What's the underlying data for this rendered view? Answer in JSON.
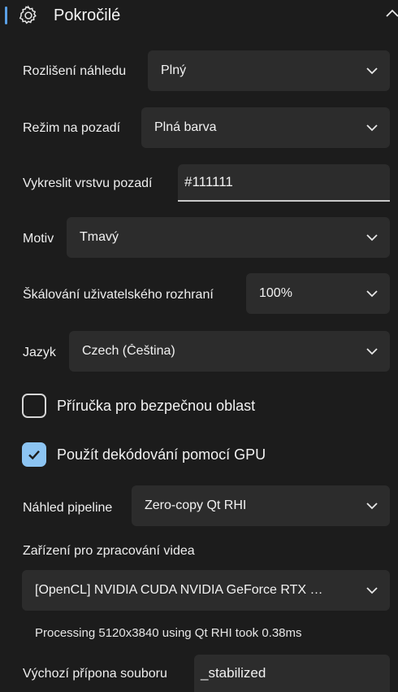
{
  "section": {
    "title": "Pokročilé",
    "gear_icon": "gear-icon",
    "collapse_icon": "chevron-up-icon"
  },
  "preview_resolution": {
    "label": "Rozlišení náhledu",
    "value": "Plný"
  },
  "background_mode": {
    "label": "Režim na pozadí",
    "value": "Plná barva"
  },
  "background_layer": {
    "label": "Vykreslit vrstvu pozadí",
    "value": "#111111"
  },
  "theme": {
    "label": "Motiv",
    "value": "Tmavý"
  },
  "ui_scale": {
    "label": "Škálování uživatelského rozhraní",
    "value": "100%"
  },
  "language": {
    "label": "Jazyk",
    "value": "Czech (Čeština)"
  },
  "safe_area_guide": {
    "label": "Příručka pro bezpečnou oblast",
    "checked": false
  },
  "gpu_decoding": {
    "label": "Použít dekódování pomocí GPU",
    "checked": true
  },
  "preview_pipeline": {
    "label": "Náhled pipeline",
    "value": "Zero-copy Qt RHI"
  },
  "video_device": {
    "label": "Zařízení pro zpracování videa",
    "value": "[OpenCL] NVIDIA CUDA NVIDIA GeForce RTX …",
    "info": "Processing 5120x3840 using Qt RHI took 0.38ms"
  },
  "default_suffix": {
    "label": "Výchozí přípona souboru",
    "value": "_stabilized"
  },
  "colors": {
    "accent": "#5aa0e6",
    "checkbox_checked": "#8cc4f2",
    "background": "#1c1c1c",
    "control": "#2c2c2c"
  }
}
